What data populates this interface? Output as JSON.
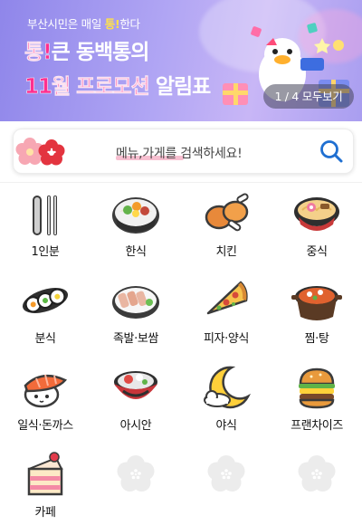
{
  "banner": {
    "subtitle_prefix": "부산시민은 매일 ",
    "subtitle_highlight": "통!",
    "subtitle_suffix": "한다",
    "line1_pink": "통!",
    "line1_white": "큰 동백통의",
    "line2_pink": "11월 프로모션",
    "line2_white": " 알림표",
    "pager": "1 / 4 모두보기"
  },
  "search": {
    "placeholder": "메뉴,가게를 검색하세요!"
  },
  "categories": [
    {
      "label": "1인분",
      "icon": "single-serving-icon"
    },
    {
      "label": "한식",
      "icon": "bibimbap-icon"
    },
    {
      "label": "치킨",
      "icon": "chicken-leg-icon"
    },
    {
      "label": "중식",
      "icon": "noodle-bowl-icon"
    },
    {
      "label": "분식",
      "icon": "gimbap-icon"
    },
    {
      "label": "족발·보쌈",
      "icon": "bossam-plate-icon"
    },
    {
      "label": "피자·양식",
      "icon": "pizza-slice-icon"
    },
    {
      "label": "찜·탕",
      "icon": "stew-pot-icon"
    },
    {
      "label": "일식·돈까스",
      "icon": "sushi-icon"
    },
    {
      "label": "아시안",
      "icon": "asian-bowl-icon"
    },
    {
      "label": "야식",
      "icon": "moon-icon"
    },
    {
      "label": "프랜차이즈",
      "icon": "burger-icon"
    },
    {
      "label": "카페",
      "icon": "cake-icon"
    },
    {
      "label": "",
      "icon": "placeholder-flower-icon"
    },
    {
      "label": "",
      "icon": "placeholder-flower-icon"
    },
    {
      "label": "",
      "icon": "placeholder-flower-icon"
    }
  ],
  "colors": {
    "accent_pink": "#ff2f8e",
    "search_blue": "#1f6fd1",
    "banner_purple": "#9b90ee"
  }
}
